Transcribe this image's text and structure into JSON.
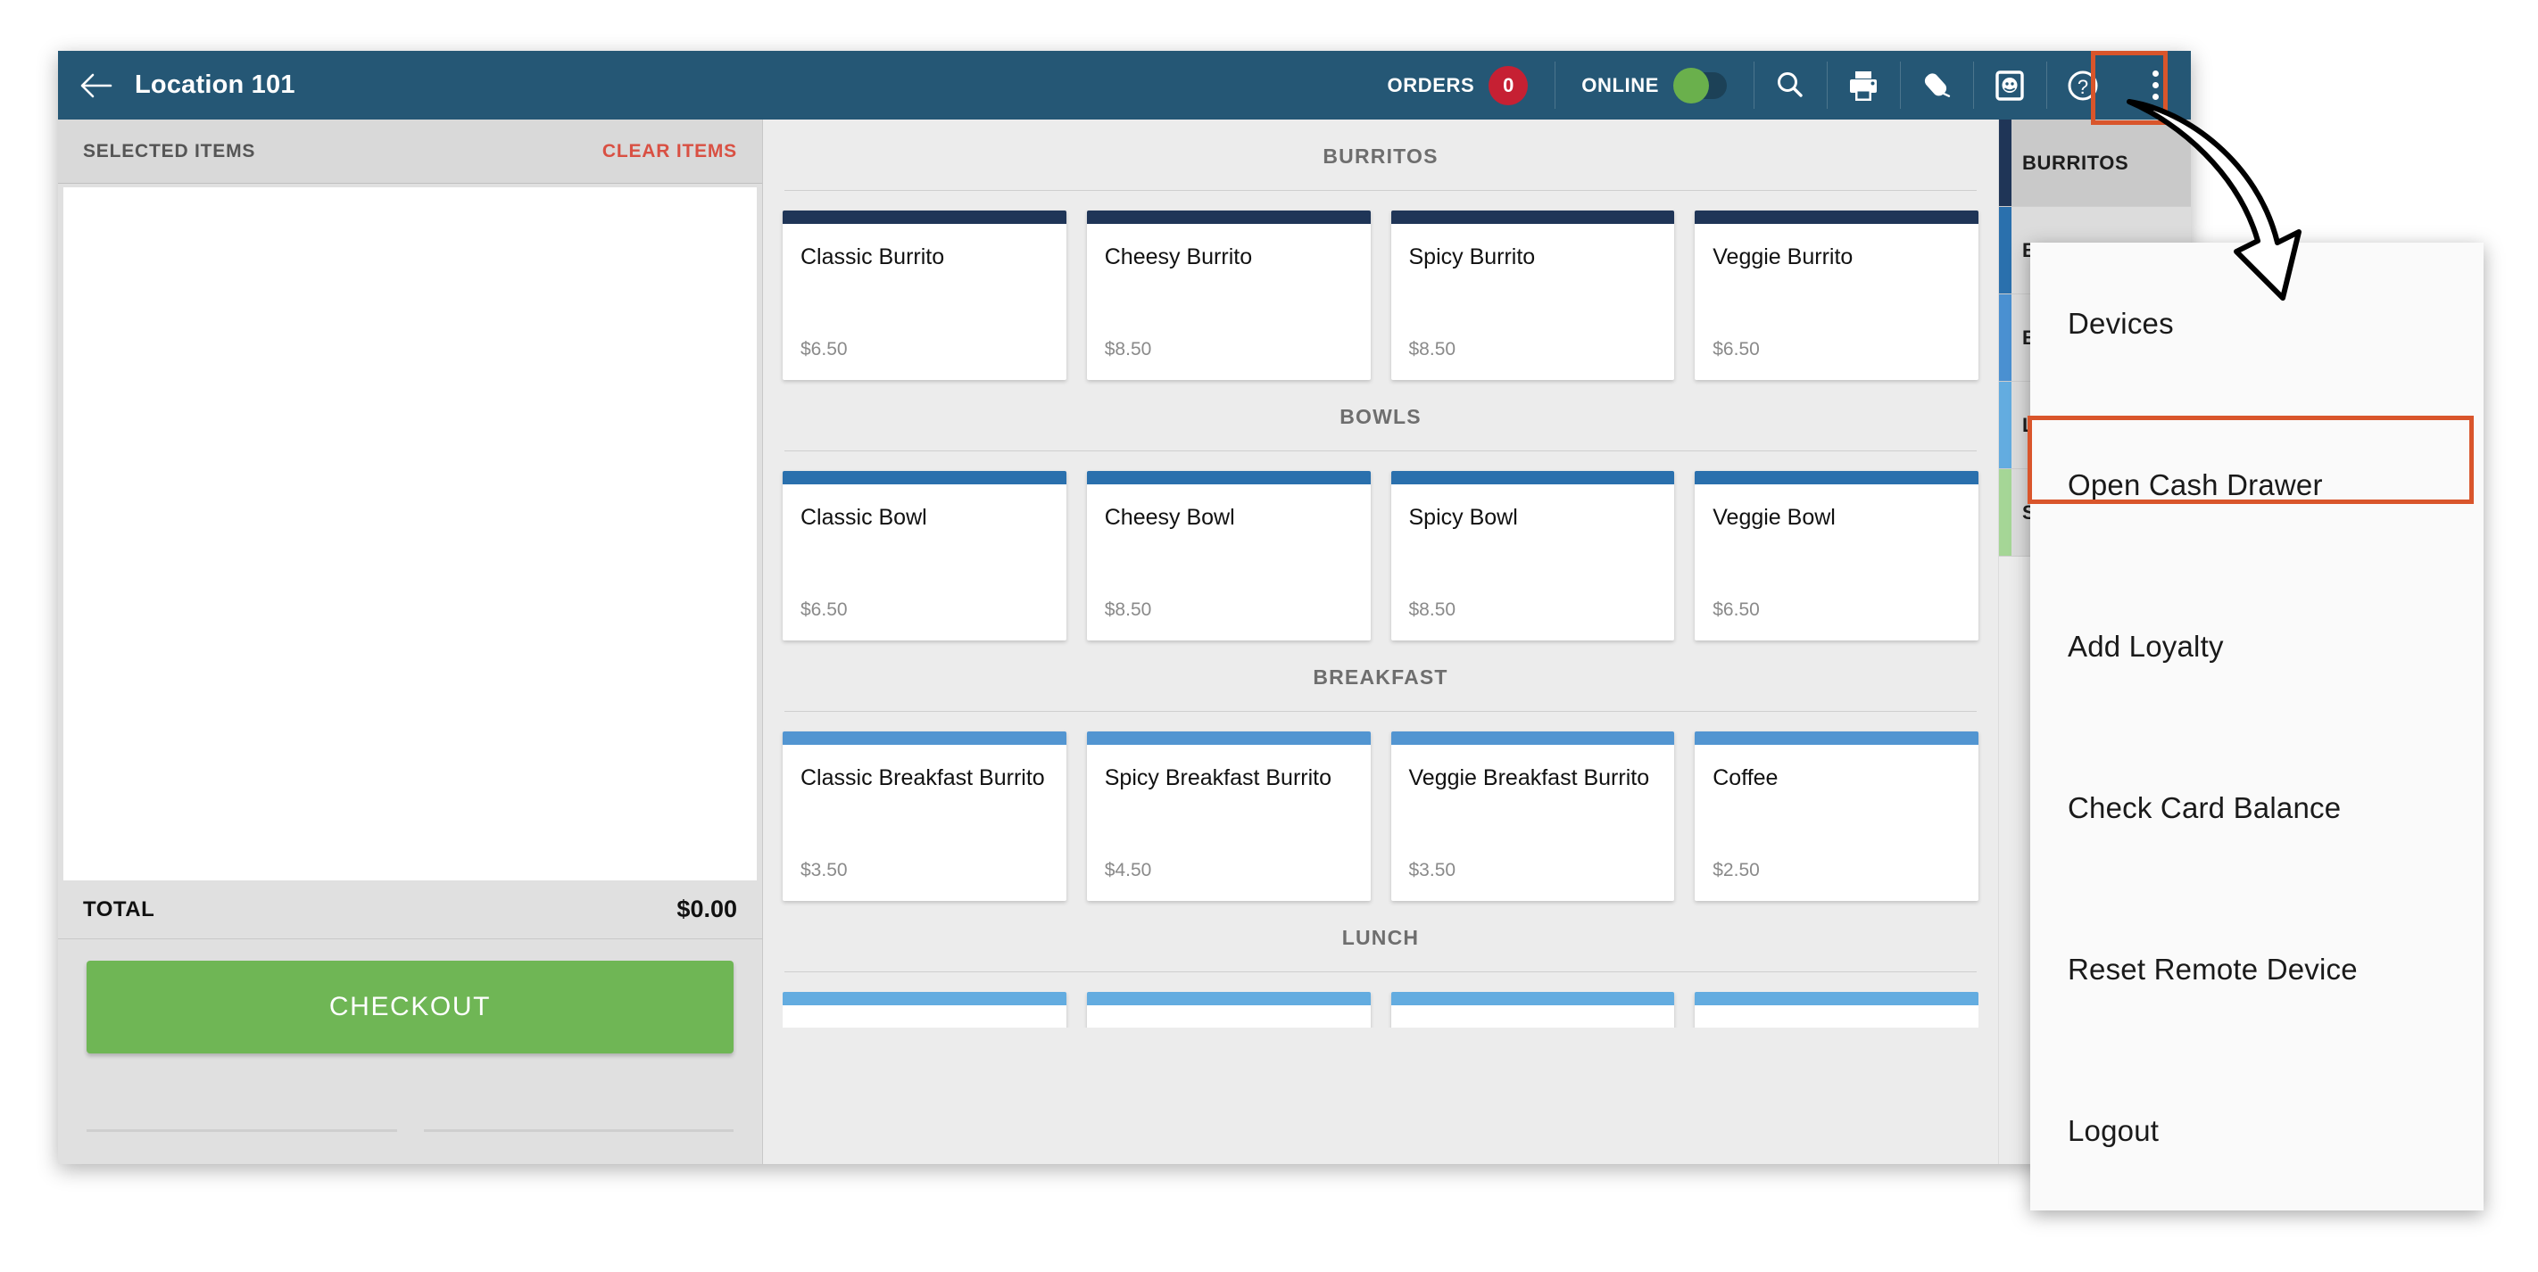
{
  "app": {
    "title": "Location 101",
    "back_icon": "back-arrow-icon"
  },
  "toolbar": {
    "orders_label": "ORDERS",
    "orders_count": "0",
    "orders_badge_color": "#c62033",
    "online_label": "ONLINE",
    "online_on": true,
    "online_knob_color": "#6ab04c",
    "icons": [
      {
        "name": "search-icon"
      },
      {
        "name": "printer-icon"
      },
      {
        "name": "tag-icon"
      },
      {
        "name": "customer-display-icon"
      },
      {
        "name": "help-circle-icon"
      }
    ],
    "overflow_icon": "overflow-menu-icon"
  },
  "cart": {
    "header_title": "SELECTED ITEMS",
    "clear_label": "CLEAR ITEMS",
    "total_label": "TOTAL",
    "total_value": "$0.00",
    "checkout_label": "CHECKOUT",
    "checkout_color": "#6fb655",
    "items": []
  },
  "menu": {
    "sections": [
      {
        "title": "BURRITOS",
        "accent": "#1f3557",
        "items": [
          {
            "name": "Classic Burrito",
            "price": "$6.50"
          },
          {
            "name": "Cheesy Burrito",
            "price": "$8.50"
          },
          {
            "name": "Spicy Burrito",
            "price": "$8.50"
          },
          {
            "name": "Veggie Burrito",
            "price": "$6.50"
          }
        ]
      },
      {
        "title": "BOWLS",
        "accent": "#2a70ad",
        "items": [
          {
            "name": "Classic Bowl",
            "price": "$6.50"
          },
          {
            "name": "Cheesy Bowl",
            "price": "$8.50"
          },
          {
            "name": "Spicy Bowl",
            "price": "$8.50"
          },
          {
            "name": "Veggie Bowl",
            "price": "$6.50"
          }
        ]
      },
      {
        "title": "BREAKFAST",
        "accent": "#5295d1",
        "items": [
          {
            "name": "Classic Breakfast Burrito",
            "price": "$3.50"
          },
          {
            "name": "Spicy Breakfast Burrito",
            "price": "$4.50"
          },
          {
            "name": "Veggie Breakfast Burrito",
            "price": "$3.50"
          },
          {
            "name": "Coffee",
            "price": "$2.50"
          }
        ]
      },
      {
        "title": "LUNCH",
        "accent": "#63ace0",
        "items": []
      }
    ]
  },
  "categories": [
    {
      "label": "BURRITOS",
      "color": "#1f3557",
      "active": true
    },
    {
      "label": "BOWLS",
      "color": "#2a70ad",
      "active": false
    },
    {
      "label": "BREAKFAST",
      "color": "#4a90d1",
      "active": false
    },
    {
      "label": "LUNCH",
      "color": "#63ace0",
      "active": false
    },
    {
      "label": "SIDES",
      "color": "#a5d696",
      "active": false
    }
  ],
  "dropdown": {
    "highlight_color": "#d9552b",
    "items": [
      {
        "label": "Devices",
        "highlighted": false
      },
      {
        "label": "Open Cash Drawer",
        "highlighted": true
      },
      {
        "label": "Add Loyalty",
        "highlighted": false
      },
      {
        "label": "Check Card Balance",
        "highlighted": false
      },
      {
        "label": "Reset Remote Device",
        "highlighted": false
      },
      {
        "label": "Logout",
        "highlighted": false
      }
    ]
  },
  "annotation": {
    "arrow": "curved-arrow-annotation",
    "highlight_color": "#d9552b"
  }
}
